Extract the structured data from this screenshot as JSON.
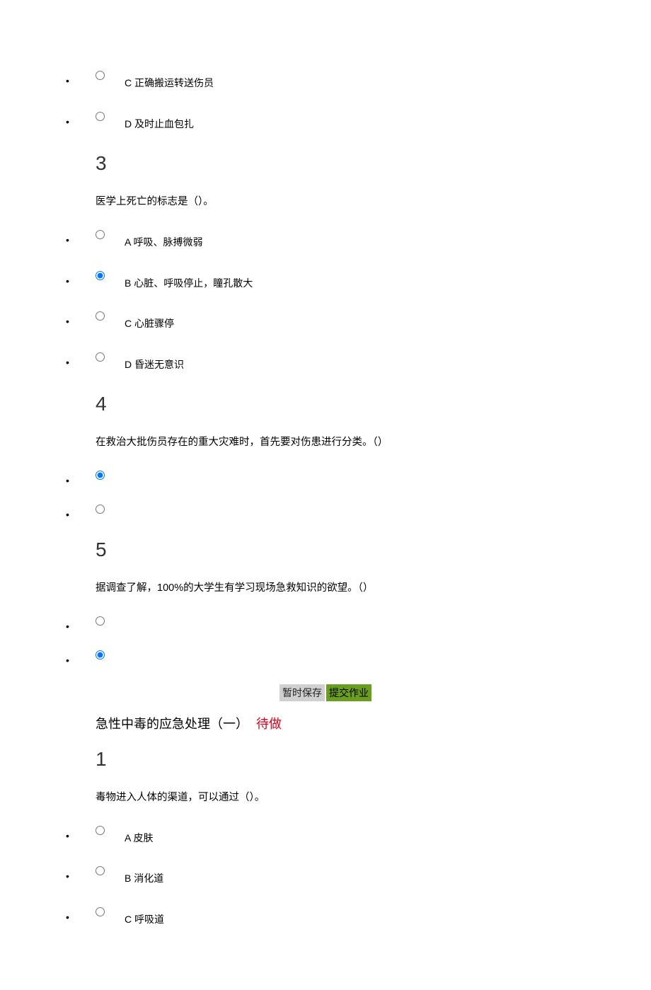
{
  "partial_options_top": [
    {
      "letter": "C",
      "text": "正确搬运转送伤员",
      "selected": false
    },
    {
      "letter": "D",
      "text": "及时止血包扎",
      "selected": false
    }
  ],
  "q3": {
    "number": "3",
    "text": "医学上死亡的标志是（）。",
    "options": [
      {
        "letter": "A",
        "text": "呼吸、脉搏微弱",
        "selected": false
      },
      {
        "letter": "B",
        "text": "心脏、呼吸停止，瞳孔散大",
        "selected": true
      },
      {
        "letter": "C",
        "text": "心脏骤停",
        "selected": false
      },
      {
        "letter": "D",
        "text": "昏迷无意识",
        "selected": false
      }
    ]
  },
  "q4": {
    "number": "4",
    "text": "在救治大批伤员存在的重大灾难时，首先要对伤患进行分类。（）",
    "options": [
      {
        "selected": true
      },
      {
        "selected": false
      }
    ]
  },
  "q5": {
    "number": "5",
    "text": "据调查了解，100%的大学生有学习现场急救知识的欲望。（）",
    "options": [
      {
        "selected": false
      },
      {
        "selected": true
      }
    ]
  },
  "buttons": {
    "save_label": "暂时保存",
    "submit_label": "提交作业"
  },
  "section2": {
    "title": "急性中毒的应急处理（一）",
    "status": "待做"
  },
  "q1_sec2": {
    "number": "1",
    "text": "毒物进入人体的渠道，可以通过（）。",
    "options": [
      {
        "letter": "A",
        "text": "皮肤",
        "selected": false
      },
      {
        "letter": "B",
        "text": "消化道",
        "selected": false
      },
      {
        "letter": "C",
        "text": "呼吸道",
        "selected": false
      }
    ]
  }
}
